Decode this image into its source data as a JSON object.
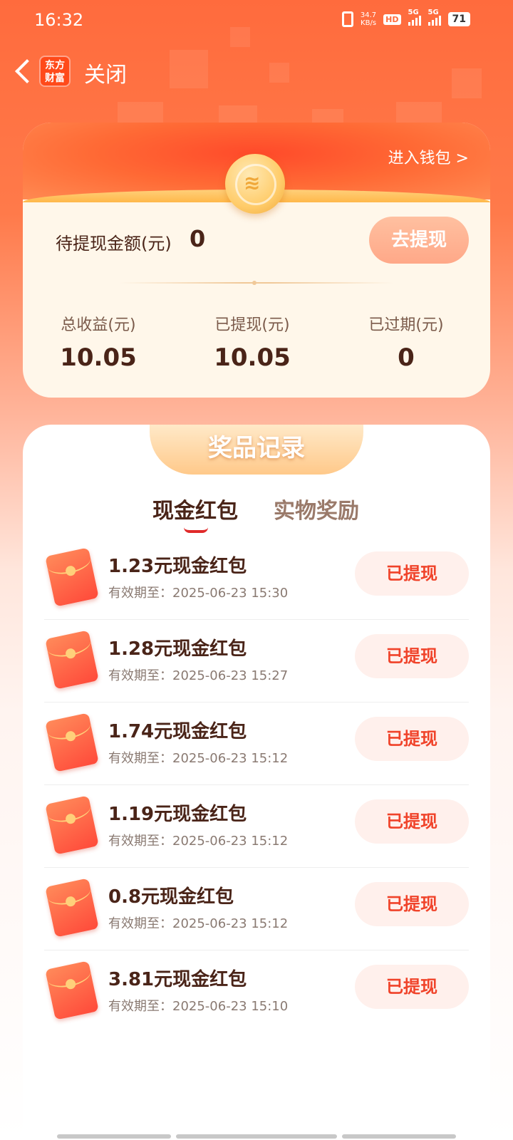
{
  "status_bar": {
    "time": "16:32",
    "net_speed_value": "34.7",
    "net_speed_unit": "KB/s",
    "hd_label": "HD",
    "sim1_label": "5G",
    "sim2_label": "5G",
    "battery": "71"
  },
  "header": {
    "logo_text": "东方财富",
    "close_label": "关闭"
  },
  "wallet": {
    "enter_wallet": "进入钱包 >",
    "pending_label": "待提现金额(元)",
    "pending_value": "0",
    "withdraw_button": "去提现",
    "stats": [
      {
        "label": "总收益(元)",
        "value": "10.05"
      },
      {
        "label": "已提现(元)",
        "value": "10.05"
      },
      {
        "label": "已过期(元)",
        "value": "0"
      }
    ]
  },
  "records": {
    "title": "奖品记录",
    "tabs": [
      {
        "label": "现金红包",
        "active": true
      },
      {
        "label": "实物奖励",
        "active": false
      }
    ],
    "items": [
      {
        "title": "1.23元现金红包",
        "expiry": "有效期至：2025-06-23 15:30",
        "status": "已提现"
      },
      {
        "title": "1.28元现金红包",
        "expiry": "有效期至：2025-06-23 15:27",
        "status": "已提现"
      },
      {
        "title": "1.74元现金红包",
        "expiry": "有效期至：2025-06-23 15:12",
        "status": "已提现"
      },
      {
        "title": "1.19元现金红包",
        "expiry": "有效期至：2025-06-23 15:12",
        "status": "已提现"
      },
      {
        "title": "0.8元现金红包",
        "expiry": "有效期至：2025-06-23 15:12",
        "status": "已提现"
      },
      {
        "title": "3.81元现金红包",
        "expiry": "有效期至：2025-06-23 15:10",
        "status": "已提现"
      }
    ]
  },
  "colors": {
    "brand_orange": "#ff6b3d",
    "accent_red": "#f0432a",
    "text_dark": "#4a2418"
  }
}
